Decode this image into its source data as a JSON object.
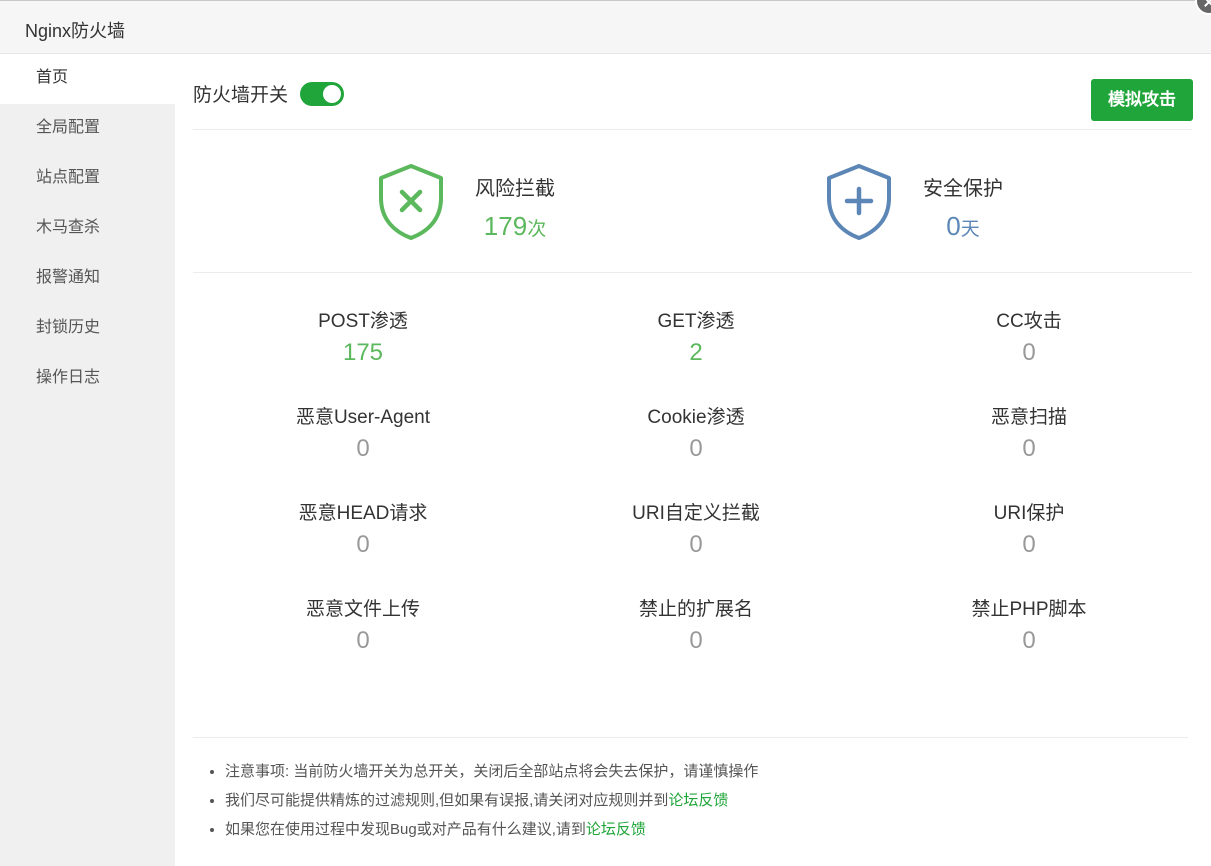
{
  "window": {
    "title": "Nginx防火墙"
  },
  "sidebar": {
    "items": [
      {
        "label": "首页",
        "active": true
      },
      {
        "label": "全局配置"
      },
      {
        "label": "站点配置"
      },
      {
        "label": "木马查杀"
      },
      {
        "label": "报警通知"
      },
      {
        "label": "封锁历史"
      },
      {
        "label": "操作日志"
      }
    ]
  },
  "header": {
    "toggle_label": "防火墙开关",
    "toggle_on": true,
    "simulate_button": "模拟攻击"
  },
  "summary": {
    "risk": {
      "label": "风险拦截",
      "value": "179",
      "unit": "次",
      "icon": "shield-x-icon",
      "color": "#5cb85c"
    },
    "safe": {
      "label": "安全保护",
      "value": "0",
      "unit": "天",
      "icon": "shield-plus-icon",
      "color": "#5b86b6"
    }
  },
  "stats": [
    {
      "label": "POST渗透",
      "value": "175"
    },
    {
      "label": "GET渗透",
      "value": "2"
    },
    {
      "label": "CC攻击",
      "value": "0"
    },
    {
      "label": "恶意User-Agent",
      "value": "0"
    },
    {
      "label": "Cookie渗透",
      "value": "0"
    },
    {
      "label": "恶意扫描",
      "value": "0"
    },
    {
      "label": "恶意HEAD请求",
      "value": "0"
    },
    {
      "label": "URI自定义拦截",
      "value": "0"
    },
    {
      "label": "URI保护",
      "value": "0"
    },
    {
      "label": "恶意文件上传",
      "value": "0"
    },
    {
      "label": "禁止的扩展名",
      "value": "0"
    },
    {
      "label": "禁止PHP脚本",
      "value": "0"
    }
  ],
  "notes": [
    {
      "text": "注意事项: 当前防火墙开关为总开关，关闭后全部站点将会失去保护，请谨慎操作",
      "link": ""
    },
    {
      "text": "我们尽可能提供精炼的过滤规则,但如果有误报,请关闭对应规则并到",
      "link": "论坛反馈"
    },
    {
      "text": "如果您在使用过程中发现Bug或对产品有什么建议,请到",
      "link": "论坛反馈"
    }
  ]
}
